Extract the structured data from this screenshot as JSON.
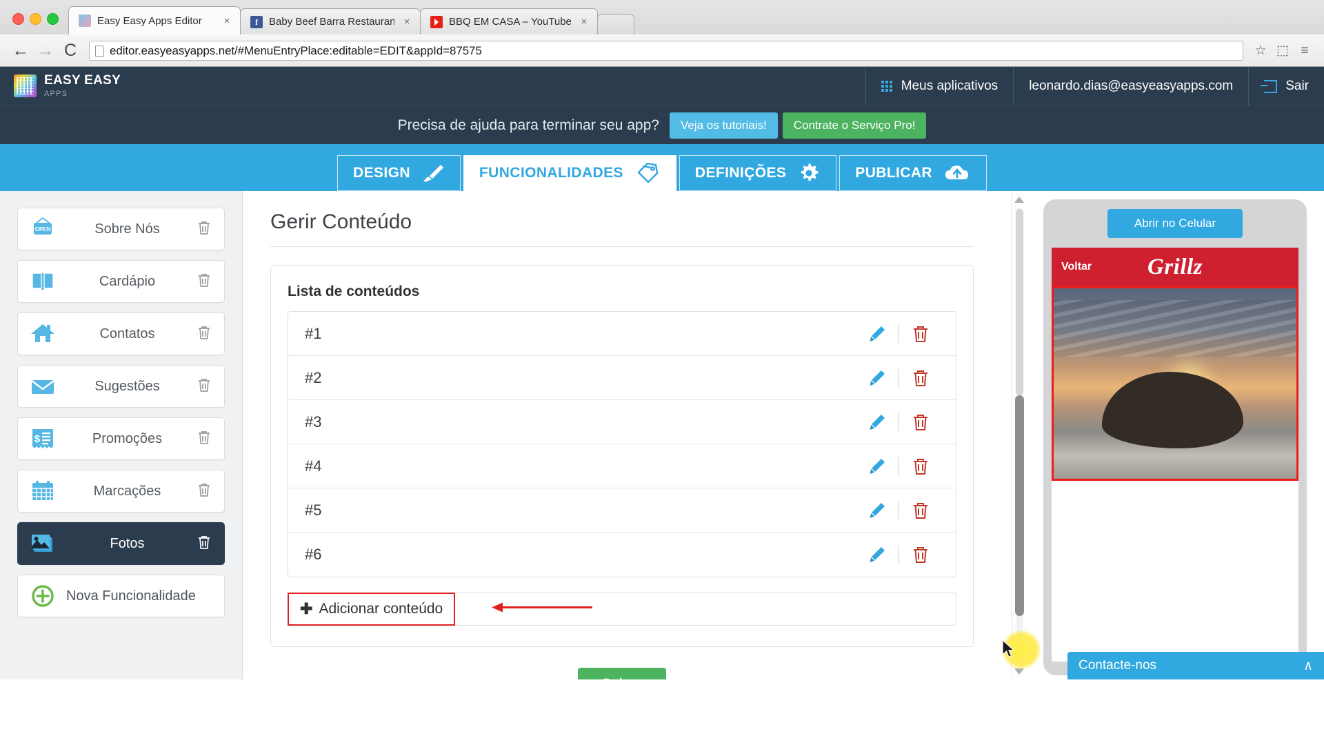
{
  "browser": {
    "tabs": [
      {
        "title": "Easy Easy Apps Editor",
        "favicon": "easyeasy-favicon",
        "active": true,
        "close": "×"
      },
      {
        "title": "Baby Beef Barra Restaurant",
        "favicon": "facebook-favicon",
        "active": false,
        "close": "×"
      },
      {
        "title": "BBQ EM CASA – YouTube",
        "favicon": "youtube-favicon",
        "active": false,
        "close": "×"
      }
    ],
    "nav": {
      "back": "←",
      "forward": "→",
      "reload": "C"
    },
    "url": "editor.easyeasyapps.net/#MenuEntryPlace:editable=EDIT&appId=87575",
    "omni_icons": {
      "bookmark": "☆",
      "window": "⬚",
      "menu": "≡"
    }
  },
  "header": {
    "brand_line1": "EASY EASY",
    "brand_line2": "APPS",
    "my_apps": "Meus aplicativos",
    "user_email": "leonardo.dias@easyeasyapps.com",
    "logout": "Sair"
  },
  "promo": {
    "text": "Precisa de ajuda para terminar seu app?",
    "tutorials_button": "Veja os tutoriais!",
    "pro_button": "Contrate o Serviço Pro!"
  },
  "main_tabs": [
    {
      "label": "DESIGN",
      "icon": "brush-icon",
      "active": false
    },
    {
      "label": "FUNCIONALIDADES",
      "icon": "tags-icon",
      "active": true
    },
    {
      "label": "DEFINIÇÕES",
      "icon": "gear-icon",
      "active": false
    },
    {
      "label": "PUBLICAR",
      "icon": "upload-cloud-icon",
      "active": false
    }
  ],
  "sidebar": {
    "items": [
      {
        "label": "Sobre Nós",
        "icon": "open-sign-icon",
        "selected": false
      },
      {
        "label": "Cardápio",
        "icon": "book-icon",
        "selected": false
      },
      {
        "label": "Contatos",
        "icon": "house-icon",
        "selected": false
      },
      {
        "label": "Sugestões",
        "icon": "envelope-icon",
        "selected": false
      },
      {
        "label": "Promoções",
        "icon": "receipt-icon",
        "selected": false
      },
      {
        "label": "Marcações",
        "icon": "calendar-icon",
        "selected": false
      },
      {
        "label": "Fotos",
        "icon": "photos-icon",
        "selected": true
      }
    ],
    "add_label": "Nova Funcionalidade",
    "add_icon": "plus-circle-icon",
    "trash_icon": "trash-icon"
  },
  "main": {
    "page_title": "Gerir Conteúdo",
    "list_heading": "Lista de conteúdos",
    "rows": [
      {
        "label": "#1"
      },
      {
        "label": "#2"
      },
      {
        "label": "#3"
      },
      {
        "label": "#4"
      },
      {
        "label": "#5"
      },
      {
        "label": "#6"
      }
    ],
    "edit_icon": "pencil-icon",
    "delete_icon": "trash-icon",
    "add_content_label": "Adicionar conteúdo",
    "add_content_plus": "✚",
    "save_label": "Salvar"
  },
  "preview": {
    "open_mobile": "Abrir no Celular",
    "phone_back": "Voltar",
    "phone_brand": "Grillz",
    "contact_label": "Contacte-nos",
    "contact_chevron": "∧"
  },
  "colors": {
    "accent_blue": "#31a8e0",
    "dark_navy": "#2b3c4e",
    "green": "#4cb360",
    "red_highlight": "#e02020",
    "phone_red": "#cf2030"
  }
}
